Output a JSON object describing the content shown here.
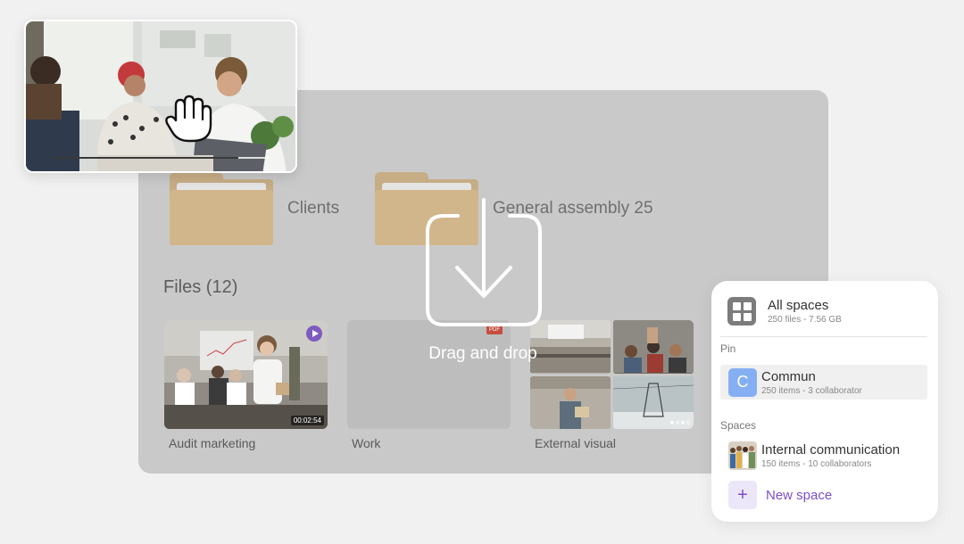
{
  "folders": [
    {
      "name": "Clients"
    },
    {
      "name": "General assembly 25"
    }
  ],
  "files": {
    "title": "Files (12)",
    "items": [
      {
        "name": "Audit marketing",
        "duration": "00:02:54"
      },
      {
        "name": "Work",
        "badge": "PDF",
        "watermark": "PDF"
      },
      {
        "name": "External visual",
        "count": "■ 4  ■ 6"
      }
    ]
  },
  "drop": {
    "label": "Drag and drop"
  },
  "preview": {
    "progress": 0.86
  },
  "spaces_panel": {
    "all": {
      "title": "All spaces",
      "sub": "250 files - 7.56 GB"
    },
    "pin_label": "Pin",
    "pinned": {
      "initial": "C",
      "title": "Commun",
      "sub": "250 items - 3 collaborator"
    },
    "spaces_label": "Spaces",
    "space": {
      "title": "Internal communication",
      "sub": "150 items - 10 collaborators"
    },
    "new_space": {
      "icon": "+",
      "label": "New space"
    }
  },
  "colors": {
    "accent": "#7b4fc8",
    "folder": "#d2b68b",
    "pin_avatar": "#86aef2",
    "panel": "#c9c9c9"
  }
}
